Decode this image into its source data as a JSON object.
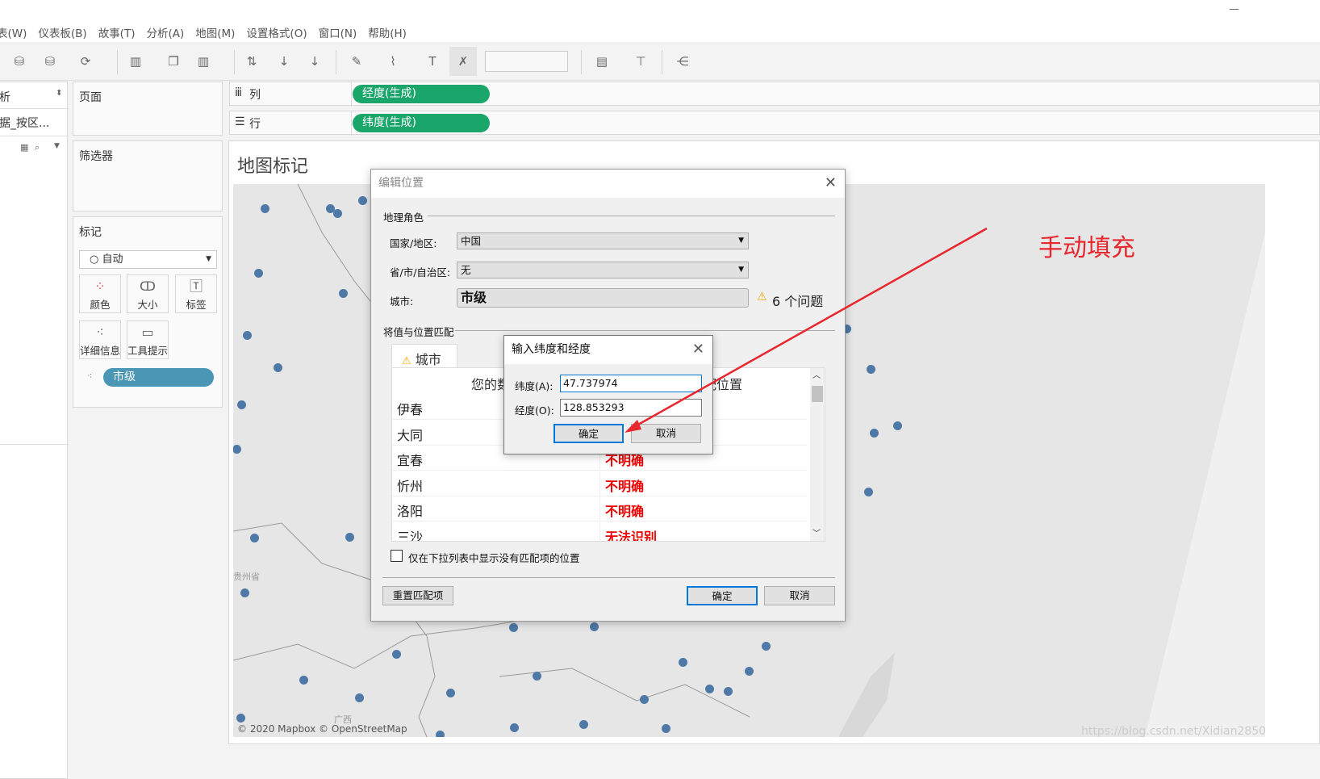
{
  "menu": [
    "表(W)",
    "仪表板(B)",
    "故事(T)",
    "分析(A)",
    "地图(M)",
    "设置格式(O)",
    "窗口(N)",
    "帮助(H)"
  ],
  "datapane": {
    "tab": "析",
    "source": "据_按区..."
  },
  "cards": {
    "pages": "页面",
    "filters": "筛选器",
    "marks": "标记",
    "mark_type": "自动",
    "mark_buttons": [
      "颜色",
      "大小",
      "标签",
      "详细信息",
      "工具提示"
    ],
    "detail_pill": "市级"
  },
  "shelves": {
    "columns_label": "列",
    "columns_pill": "经度(生成)",
    "rows_label": "行",
    "rows_pill": "纬度(生成)"
  },
  "sheet": {
    "title": "地图标记",
    "attribution": "© 2020 Mapbox © OpenStreetMap",
    "map_labels": [
      "贵州省",
      "广西"
    ]
  },
  "edit_dialog": {
    "title": "编辑位置",
    "geo_role_group": "地理角色",
    "country_label": "国家/地区:",
    "country_value": "中国",
    "province_label": "省/市/自治区:",
    "province_value": "无",
    "city_label": "城市:",
    "city_value": "市级",
    "issues": "6 个问题",
    "match_group": "将值与位置匹配",
    "tab": "城市",
    "col_headers": [
      "您的数据",
      "匹配位置"
    ],
    "rows": [
      {
        "value": "伊春",
        "status": ""
      },
      {
        "value": "大同",
        "status": ""
      },
      {
        "value": "宜春",
        "status": "不明确"
      },
      {
        "value": "忻州",
        "status": "不明确"
      },
      {
        "value": "洛阳",
        "status": "不明确"
      },
      {
        "value": "三沙",
        "status": "无法识别"
      }
    ],
    "checkbox_label": "仅在下拉列表中显示没有匹配项的位置",
    "checkbox_checked": false,
    "reset": "重置匹配项",
    "ok": "确定",
    "cancel": "取消"
  },
  "latlon_dialog": {
    "title": "输入纬度和经度",
    "lat_label": "纬度(A):",
    "lat_value": "47.737974",
    "lon_label": "经度(O):",
    "lon_value": "128.853293",
    "ok": "确定",
    "cancel": "取消"
  },
  "annotation": {
    "text": "手动填充",
    "color": "#e8262d"
  },
  "watermark": "https://blog.csdn.net/Xidian2850",
  "colors": {
    "pill_green": "#1aa56b",
    "pill_blue": "#4a96b4",
    "dot": "#4e79a7",
    "error": "#e00000"
  }
}
